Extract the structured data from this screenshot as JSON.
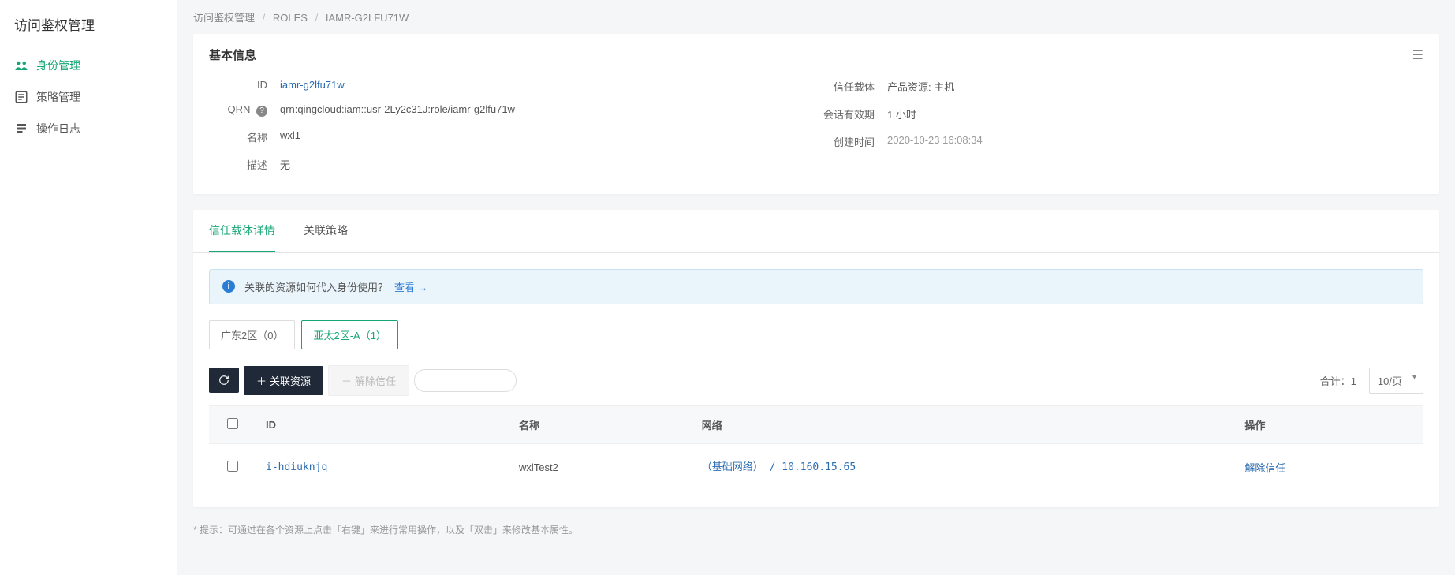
{
  "sidebar": {
    "title": "访问鉴权管理",
    "items": [
      {
        "label": "身份管理",
        "icon": "identity-icon",
        "active": true
      },
      {
        "label": "策略管理",
        "icon": "policy-icon",
        "active": false
      },
      {
        "label": "操作日志",
        "icon": "log-icon",
        "active": false
      }
    ]
  },
  "breadcrumb": {
    "parts": [
      "访问鉴权管理",
      "ROLES",
      "IAMR-G2LFU71W"
    ]
  },
  "basic": {
    "title": "基本信息",
    "left": {
      "id_label": "ID",
      "id_value": "iamr-g2lfu71w",
      "qrn_label": "QRN",
      "qrn_value": "qrn:qingcloud:iam::usr-2Ly2c31J:role/iamr-g2lfu71w",
      "name_label": "名称",
      "name_value": "wxl1",
      "desc_label": "描述",
      "desc_value": "无"
    },
    "right": {
      "trust_label": "信任载体",
      "trust_value": "产品资源: 主机",
      "session_label": "会话有效期",
      "session_value": "1 小时",
      "created_label": "创建时间",
      "created_value": "2020-10-23 16:08:34"
    }
  },
  "tabs": {
    "items": [
      "信任载体详情",
      "关联策略"
    ],
    "active": 0
  },
  "notice": {
    "text": "关联的资源如何代入身份使用？",
    "link": "查看 →"
  },
  "regions": {
    "items": [
      {
        "label": "广东2区（0）",
        "active": false
      },
      {
        "label": "亚太2区-A（1）",
        "active": true
      }
    ]
  },
  "toolbar": {
    "refresh_title": "刷新",
    "assoc_label": "关联资源",
    "remove_label": "解除信任",
    "search_placeholder": "",
    "total_label": "合计：",
    "total_count": "1",
    "page_size": "10/页"
  },
  "table": {
    "headers": [
      "",
      "ID",
      "名称",
      "网络",
      "操作"
    ],
    "rows": [
      {
        "id": "i-hdiuknjq",
        "name": "wxlTest2",
        "network": "（基础网络） / 10.160.15.65",
        "action": "解除信任"
      }
    ]
  },
  "hint": "* 提示：可通过在各个资源上点击「右键」来进行常用操作，以及「双击」来修改基本属性。"
}
